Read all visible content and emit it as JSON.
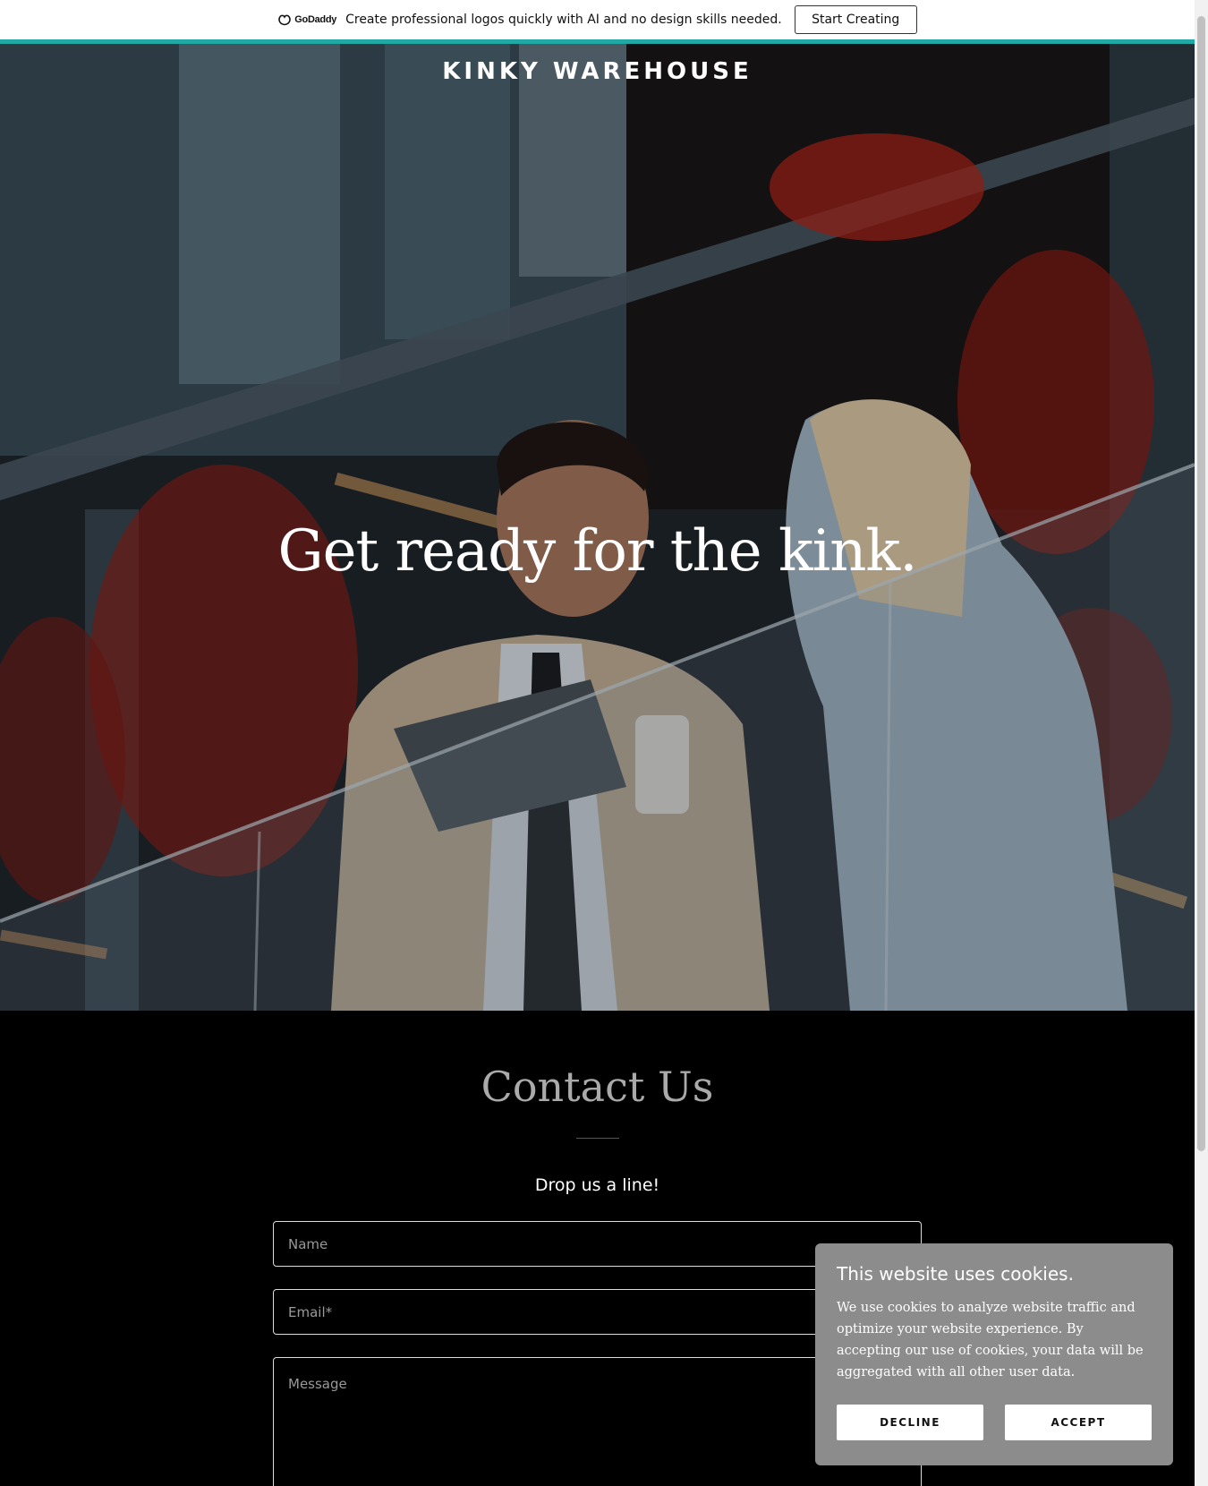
{
  "promo": {
    "brand": "GoDaddy",
    "text": "Create professional logos quickly with AI and no design skills needed.",
    "button_label": "Start Creating"
  },
  "hero": {
    "site_title": "KINKY WAREHOUSE",
    "tagline": "Get ready for the kink."
  },
  "contact": {
    "title": "Contact Us",
    "subtitle": "Drop us a line!",
    "name_placeholder": "Name",
    "email_placeholder": "Email*",
    "message_placeholder": "Message"
  },
  "cookie": {
    "title": "This website uses cookies.",
    "text": "We use cookies to analyze website traffic and optimize your website experience. By accepting our use of cookies, your data will be aggregated with all other user data.",
    "decline_label": "DECLINE",
    "accept_label": "ACCEPT"
  },
  "colors": {
    "accent_bar": "#1fa8a4",
    "cookie_bg": "#8c8c8c"
  }
}
